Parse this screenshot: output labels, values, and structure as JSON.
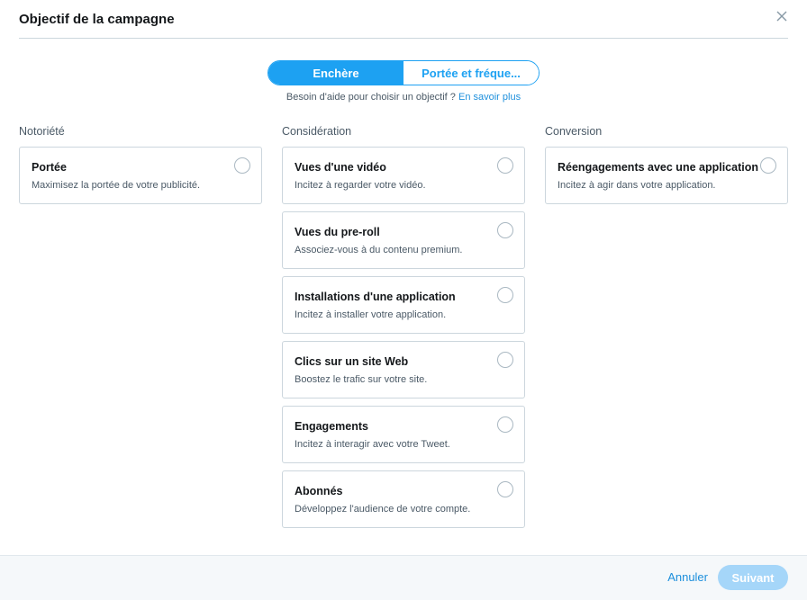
{
  "dialog": {
    "title": "Objectif de la campagne",
    "close_icon": "close-icon"
  },
  "toggle": {
    "options": [
      "Enchère",
      "Portée et fréque..."
    ],
    "selected": "Enchère"
  },
  "help": {
    "text": "Besoin d'aide pour choisir un objectif ? ",
    "link": "En savoir plus"
  },
  "columns": [
    {
      "title": "Notoriété",
      "cards": [
        {
          "title": "Portée",
          "desc": "Maximisez la portée de votre publicité."
        }
      ]
    },
    {
      "title": "Considération",
      "cards": [
        {
          "title": "Vues d'une vidéo",
          "desc": "Incitez à regarder votre vidéo."
        },
        {
          "title": "Vues du pre-roll",
          "desc": "Associez-vous à du contenu premium."
        },
        {
          "title": "Installations d'une application",
          "desc": "Incitez à installer votre application."
        },
        {
          "title": "Clics sur un site Web",
          "desc": "Boostez le trafic sur votre site."
        },
        {
          "title": "Engagements",
          "desc": "Incitez à interagir avec votre Tweet."
        },
        {
          "title": "Abonnés",
          "desc": "Développez l'audience de votre compte."
        }
      ]
    },
    {
      "title": "Conversion",
      "cards": [
        {
          "title": "Réengagements avec une application",
          "desc": "Incitez à agir dans votre application."
        }
      ]
    }
  ],
  "footer": {
    "cancel_label": "Annuler",
    "next_label": "Suivant"
  },
  "colors": {
    "accent": "#1da1f2",
    "link": "#1d8fdc",
    "next_disabled": "#a5d6f9",
    "border": "#ccd6dd",
    "footer_bg": "#f5f8fa"
  }
}
